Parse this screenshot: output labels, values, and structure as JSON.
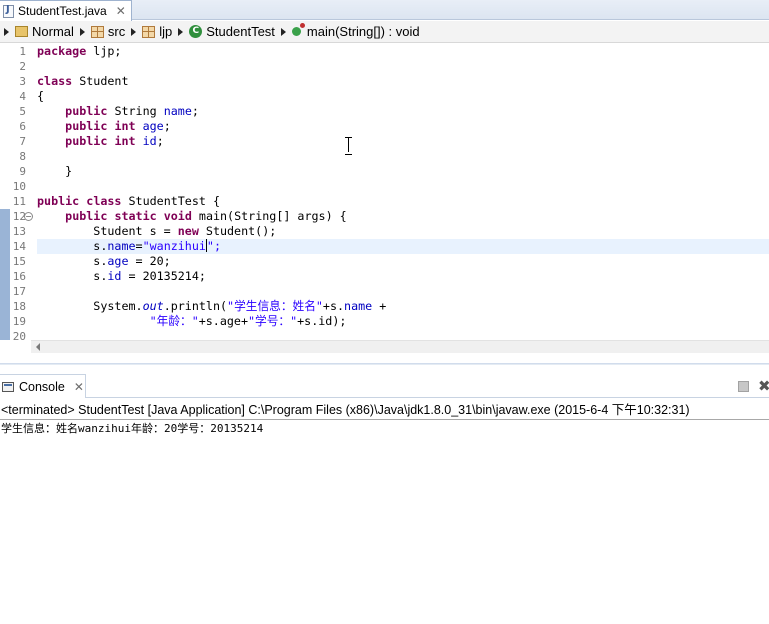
{
  "editor_tab": {
    "label": "StudentTest.java",
    "close": "✕"
  },
  "breadcrumb": {
    "items": [
      "Normal",
      "src",
      "ljp",
      "StudentTest",
      "main(String[]) : void"
    ],
    "icons": [
      "project-icon",
      "source-folder-icon",
      "package-icon",
      "class-icon",
      "method-icon"
    ]
  },
  "editor": {
    "line_numbers": [
      "1",
      "2",
      "3",
      "4",
      "5",
      "6",
      "7",
      "8",
      "9",
      "10",
      "11",
      "12",
      "13",
      "14",
      "15",
      "16",
      "17",
      "18",
      "19",
      "20"
    ],
    "lines": [
      "package ljp;",
      "",
      "class Student",
      "{",
      "    public String name;",
      "    public int age;",
      "    public int id;",
      "",
      "    }",
      "",
      "public class StudentTest {",
      "    public static void main(String[] args) {",
      "        Student s = new Student();",
      "        s.name=\"wanzihui\";",
      "        s.age = 20;",
      "        s.id = 20135214;",
      "",
      "        System.out.println(\"学生信息：姓名\"+s.name +",
      "                \"年龄：\"+s.age+\"学号：\"+s.id);",
      ""
    ],
    "tokens": {
      "kw_package": "package",
      "pkg_name": " ljp;",
      "kw_class": "class",
      "cls_student": " Student",
      "brace_open": "{",
      "kw_public": "public",
      "kw_int": "int",
      "kw_static": "static",
      "kw_void": "void",
      "kw_new": "new",
      "type_string": "String",
      "f_name": "name",
      "f_age": "age",
      "f_id": "id",
      "brace_close": "}",
      "cls_studenttest": " StudentTest {",
      "main_sig": " main(String[] args) {",
      "student_decl": "Student s = ",
      "student_ctor": " Student();",
      "s_dot": "s.",
      "eq": "=",
      "str_wanzihui": "\"wanzihui",
      "quote_semi": "\";",
      "age_assign": " = 20;",
      "id_assign": " = 20135214;",
      "system": "System.",
      "out": "out",
      "println_open": ".println(",
      "str_info": "\"学生信息：姓名\"",
      "plus_s_dot": "+s.",
      "plus_tail": " +",
      "str_age": "\"年龄：\"",
      "plus_s_age": "+s.age+",
      "str_id": "\"学号：\"",
      "plus_s_id": "+s.id);"
    }
  },
  "console": {
    "tab_label": "Console",
    "tab_close": "✕",
    "clear": "✖",
    "header": "<terminated> StudentTest [Java Application] C:\\Program Files (x86)\\Java\\jdk1.8.0_31\\bin\\javaw.exe (2015-6-4 下午10:32:31)",
    "output": "学生信息：姓名wanzihui年龄：20学号：20135214"
  }
}
